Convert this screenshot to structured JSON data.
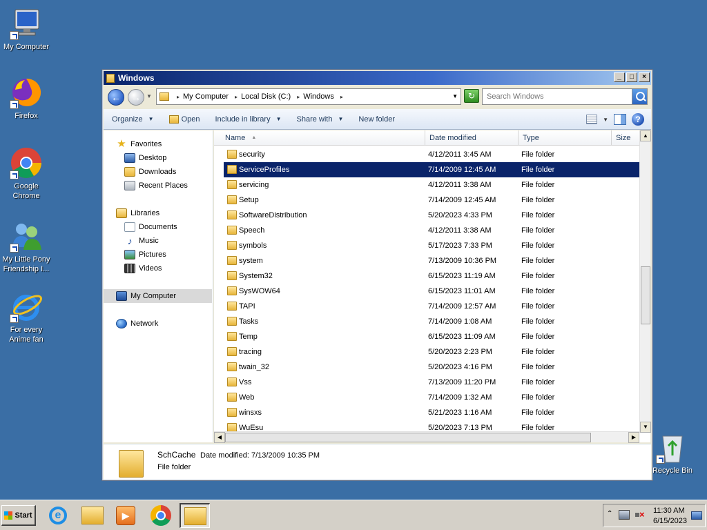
{
  "desktop": {
    "icons": [
      {
        "label": "My Computer",
        "icon": "computer-icon"
      },
      {
        "label": "Firefox",
        "icon": "firefox-icon"
      },
      {
        "label": "Google Chrome",
        "icon": "chrome-icon"
      },
      {
        "label": "My Little Pony Friendship I...",
        "icon": "users-icon"
      },
      {
        "label": "For every Anime fan",
        "icon": "internet-explorer-icon"
      },
      {
        "label": "Recycle Bin",
        "icon": "recycle-bin-icon"
      }
    ]
  },
  "window": {
    "title": "Windows",
    "controls": {
      "minimize": "_",
      "maximize": "□",
      "close": "×"
    },
    "address": {
      "crumbs": [
        "My Computer",
        "Local Disk (C:)",
        "Windows"
      ]
    },
    "search": {
      "placeholder": "Search Windows"
    },
    "toolbar": {
      "organize": "Organize",
      "open": "Open",
      "include_in_library": "Include in library",
      "share_with": "Share with",
      "new_folder": "New folder"
    },
    "nav": {
      "favorites": "Favorites",
      "desktop": "Desktop",
      "downloads": "Downloads",
      "recent_places": "Recent Places",
      "libraries": "Libraries",
      "documents": "Documents",
      "music": "Music",
      "pictures": "Pictures",
      "videos": "Videos",
      "my_computer": "My Computer",
      "network": "Network"
    },
    "columns": {
      "name": "Name",
      "date_modified": "Date modified",
      "type": "Type",
      "size": "Size"
    },
    "files": [
      {
        "name": "security",
        "date": "4/12/2011 3:45 AM",
        "type": "File folder"
      },
      {
        "name": "ServiceProfiles",
        "date": "7/14/2009 12:45 AM",
        "type": "File folder",
        "selected": true
      },
      {
        "name": "servicing",
        "date": "4/12/2011 3:38 AM",
        "type": "File folder"
      },
      {
        "name": "Setup",
        "date": "7/14/2009 12:45 AM",
        "type": "File folder"
      },
      {
        "name": "SoftwareDistribution",
        "date": "5/20/2023 4:33 PM",
        "type": "File folder"
      },
      {
        "name": "Speech",
        "date": "4/12/2011 3:38 AM",
        "type": "File folder"
      },
      {
        "name": "symbols",
        "date": "5/17/2023 7:33 PM",
        "type": "File folder"
      },
      {
        "name": "system",
        "date": "7/13/2009 10:36 PM",
        "type": "File folder"
      },
      {
        "name": "System32",
        "date": "6/15/2023 11:19 AM",
        "type": "File folder"
      },
      {
        "name": "SysWOW64",
        "date": "6/15/2023 11:01 AM",
        "type": "File folder"
      },
      {
        "name": "TAPI",
        "date": "7/14/2009 12:57 AM",
        "type": "File folder"
      },
      {
        "name": "Tasks",
        "date": "7/14/2009 1:08 AM",
        "type": "File folder"
      },
      {
        "name": "Temp",
        "date": "6/15/2023 11:09 AM",
        "type": "File folder"
      },
      {
        "name": "tracing",
        "date": "5/20/2023 2:23 PM",
        "type": "File folder"
      },
      {
        "name": "twain_32",
        "date": "5/20/2023 4:16 PM",
        "type": "File folder"
      },
      {
        "name": "Vss",
        "date": "7/13/2009 11:20 PM",
        "type": "File folder"
      },
      {
        "name": "Web",
        "date": "7/14/2009 1:32 AM",
        "type": "File folder"
      },
      {
        "name": "winsxs",
        "date": "5/21/2023 1:16 AM",
        "type": "File folder"
      },
      {
        "name": "WuEsu",
        "date": "5/20/2023 7:13 PM",
        "type": "File folder"
      }
    ],
    "details": {
      "name": "SchCache",
      "date_label": "Date modified: 7/13/2009 10:35 PM",
      "type": "File folder"
    }
  },
  "taskbar": {
    "start_label": "Start",
    "pinned": [
      "internet-explorer-icon",
      "folder-icon",
      "media-player-icon",
      "chrome-icon",
      "explorer-icon"
    ],
    "clock": {
      "time": "11:30 AM",
      "date": "6/15/2023"
    }
  },
  "colors": {
    "desktop": "#3a6ea5",
    "selection": "#0a246a",
    "title_start": "#0a246a"
  }
}
